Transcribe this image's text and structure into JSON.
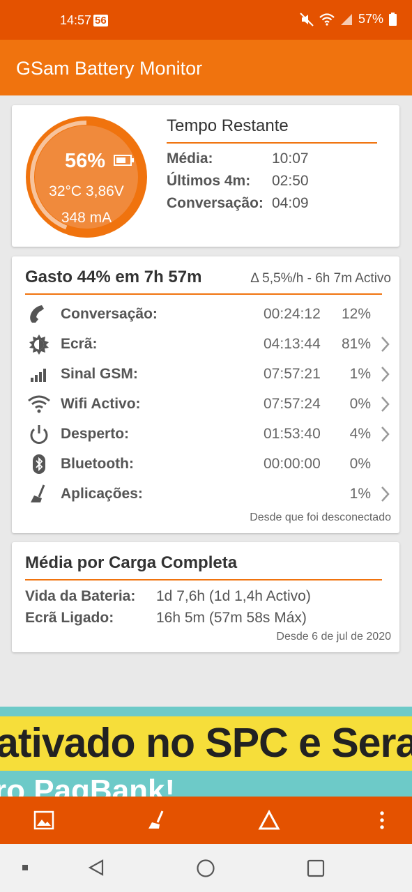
{
  "status_bar": {
    "time": "14:57",
    "badge": "56",
    "battery": "57%"
  },
  "app_bar": {
    "title": "GSam Battery Monitor"
  },
  "battery": {
    "percent": "56%",
    "temp_voltage": "32°C  3,86V",
    "current": "348 mA",
    "level": 0.56
  },
  "time_remaining": {
    "title": "Tempo Restante",
    "rows": [
      {
        "label": "Média:",
        "value": "10:07"
      },
      {
        "label": "Últimos 4m:",
        "value": "02:50"
      },
      {
        "label": "Conversação:",
        "value": "04:09"
      }
    ]
  },
  "usage": {
    "title": "Gasto 44% em 7h 57m",
    "rate": "Δ 5,5%/h - 6h 7m Activo",
    "rows": [
      {
        "icon": "phone-icon",
        "label": "Conversação:",
        "time": "00:24:12",
        "pct": "12%",
        "chevron": false
      },
      {
        "icon": "brightness-icon",
        "label": "Ecrã:",
        "time": "04:13:44",
        "pct": "81%",
        "chevron": true
      },
      {
        "icon": "signal-icon",
        "label": "Sinal GSM:",
        "time": "07:57:21",
        "pct": "1%",
        "chevron": true
      },
      {
        "icon": "wifi-icon",
        "label": "Wifi Activo:",
        "time": "07:57:24",
        "pct": "0%",
        "chevron": true
      },
      {
        "icon": "power-icon",
        "label": "Desperto:",
        "time": "01:53:40",
        "pct": "4%",
        "chevron": true
      },
      {
        "icon": "bluetooth-icon",
        "label": "Bluetooth:",
        "time": "00:00:00",
        "pct": "0%",
        "chevron": false
      },
      {
        "icon": "broom-icon",
        "label": "Aplicações:",
        "time": "",
        "pct": "1%",
        "chevron": true
      }
    ],
    "footnote": "Desde que foi desconectado"
  },
  "full_charge": {
    "title": "Média por Carga Completa",
    "rows": [
      {
        "label": "Vida da Bateria:",
        "value": "1d 7,6h (1d 1,4h Activo)"
      },
      {
        "label": "Ecrã Ligado:",
        "value": "16h 5m (57m 58s Máx)"
      }
    ],
    "footnote": "Desde 6 de jul de 2020"
  },
  "ad": {
    "line1": "ativado no SPC e Sera",
    "line2": "ro PagBank!"
  },
  "colors": {
    "primary": "#f0730e",
    "status": "#e45200",
    "text": "#555555"
  }
}
